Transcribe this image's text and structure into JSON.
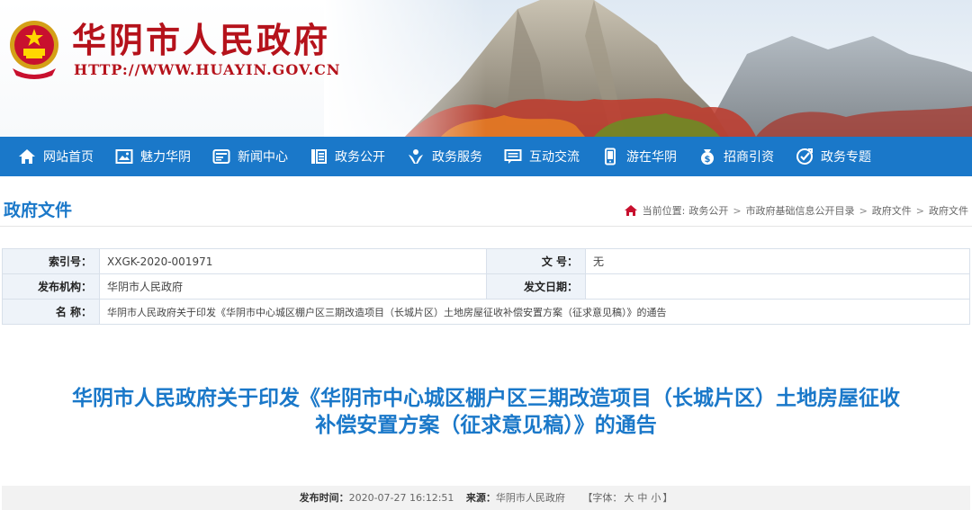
{
  "header": {
    "site_title": "华阴市人民政府",
    "site_url": "HTTP://WWW.HUAYIN.GOV.CN"
  },
  "nav": [
    {
      "label": "网站首页",
      "icon": "home-icon"
    },
    {
      "label": "魅力华阴",
      "icon": "picture-icon"
    },
    {
      "label": "新闻中心",
      "icon": "news-icon"
    },
    {
      "label": "政务公开",
      "icon": "list-icon"
    },
    {
      "label": "政务服务",
      "icon": "service-icon"
    },
    {
      "label": "互动交流",
      "icon": "chat-icon"
    },
    {
      "label": "游在华阴",
      "icon": "phone-icon"
    },
    {
      "label": "招商引资",
      "icon": "money-icon"
    },
    {
      "label": "政务专题",
      "icon": "topic-icon"
    }
  ],
  "section": {
    "title": "政府文件",
    "breadcrumb_prefix": "当前位置:",
    "breadcrumb": [
      "政务公开",
      "市政府基础信息公开目录",
      "政府文件",
      "政府文件"
    ]
  },
  "info": {
    "index_label": "索引号：",
    "index_value": "XXGK-2020-001971",
    "docno_label": "文 号：",
    "docno_value": "无",
    "publisher_label": "发布机构：",
    "publisher_value": "华阴市人民政府",
    "date_label": "发文日期：",
    "date_value": "",
    "name_label": "名 称：",
    "name_value": "华阴市人民政府关于印发《华阴市中心城区棚户区三期改造项目（长城片区）土地房屋征收补偿安置方案（征求意见稿）》的通告"
  },
  "doc": {
    "title_line1": "华阴市人民政府关于印发《华阴市中心城区棚户区三期改造项目（长城片区）土地房屋征收",
    "title_line2": "补偿安置方案（征求意见稿）》的通告"
  },
  "meta": {
    "time_label": "发布时间：",
    "time_value": "2020-07-27 16:12:51",
    "source_label": "来源：",
    "source_value": "华阴市人民政府",
    "font_open": "【字体：",
    "font_large": "大",
    "font_medium": "中",
    "font_small": "小",
    "font_close": "】"
  },
  "colors": {
    "brand_red": "#b5121b",
    "nav_blue": "#1a78c9"
  }
}
